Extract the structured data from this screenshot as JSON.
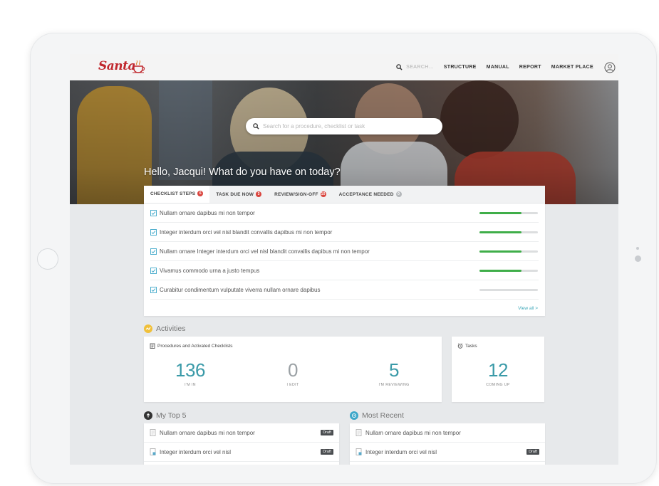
{
  "header": {
    "search_placeholder": "SEARCH...",
    "nav": [
      "STRUCTURE",
      "MANUAL",
      "REPORT",
      "MARKET PLACE"
    ]
  },
  "hero": {
    "search_placeholder": "Search for a procedure, checklist or task",
    "greeting": "Hello, Jacqui! What do you have on today?"
  },
  "tabs": [
    {
      "label": "CHECKLIST STEPS",
      "badge": "6"
    },
    {
      "label": "TASK DUE NOW",
      "badge": "3"
    },
    {
      "label": "REVIEW/SIGN-OFF",
      "badge": "10"
    },
    {
      "label": "ACCEPTANCE NEEDED",
      "badge": "0"
    }
  ],
  "checklist": [
    {
      "label": "Nullam ornare dapibus mi non tempor",
      "progress": 0.72
    },
    {
      "label": "Integer interdum orci vel nisl blandit convallis dapibus mi non tempor",
      "progress": 0.72
    },
    {
      "label": "Nullam ornare Integer interdum orci vel nisl blandit convallis dapibus mi non tempor",
      "progress": 0.72
    },
    {
      "label": "Vivamus commodo urna a justo tempus",
      "progress": 0.72
    },
    {
      "label": "Curabitur condimentum vulputate viverra nullam ornare dapibus",
      "progress": 0.0
    }
  ],
  "view_all": "View all >",
  "activities": {
    "title": "Activities",
    "procedures_title": "Procedures and Activated Checklists",
    "stats": [
      {
        "value": "136",
        "caption": "I'M IN"
      },
      {
        "value": "0",
        "caption": "I EDIT"
      },
      {
        "value": "5",
        "caption": "I'M REVIEWING"
      }
    ],
    "tasks_title": "Tasks",
    "tasks_stat": {
      "value": "12",
      "caption": "COMING UP"
    }
  },
  "top5": {
    "title": "My Top 5",
    "items": [
      {
        "label": "Nullam ornare dapibus mi non tempor",
        "badge": "Draft"
      },
      {
        "label": "Integer interdum orci vel nisl",
        "badge": "Draft"
      }
    ]
  },
  "recent": {
    "title": "Most Recent",
    "items": [
      {
        "label": "Nullam ornare dapibus mi non tempor",
        "badge": ""
      },
      {
        "label": "Integer interdum orci vel nisl",
        "badge": "Draft"
      }
    ]
  },
  "colors": {
    "accent": "#3a9aa8",
    "progress": "#3fae49",
    "badge": "#d9443d",
    "brand": "#c0272d"
  },
  "icons": [
    "search-icon",
    "user-icon",
    "checkbox-icon",
    "activity-icon",
    "clipboard-icon",
    "alarm-icon",
    "upload-icon",
    "clock-icon",
    "document-icon"
  ]
}
